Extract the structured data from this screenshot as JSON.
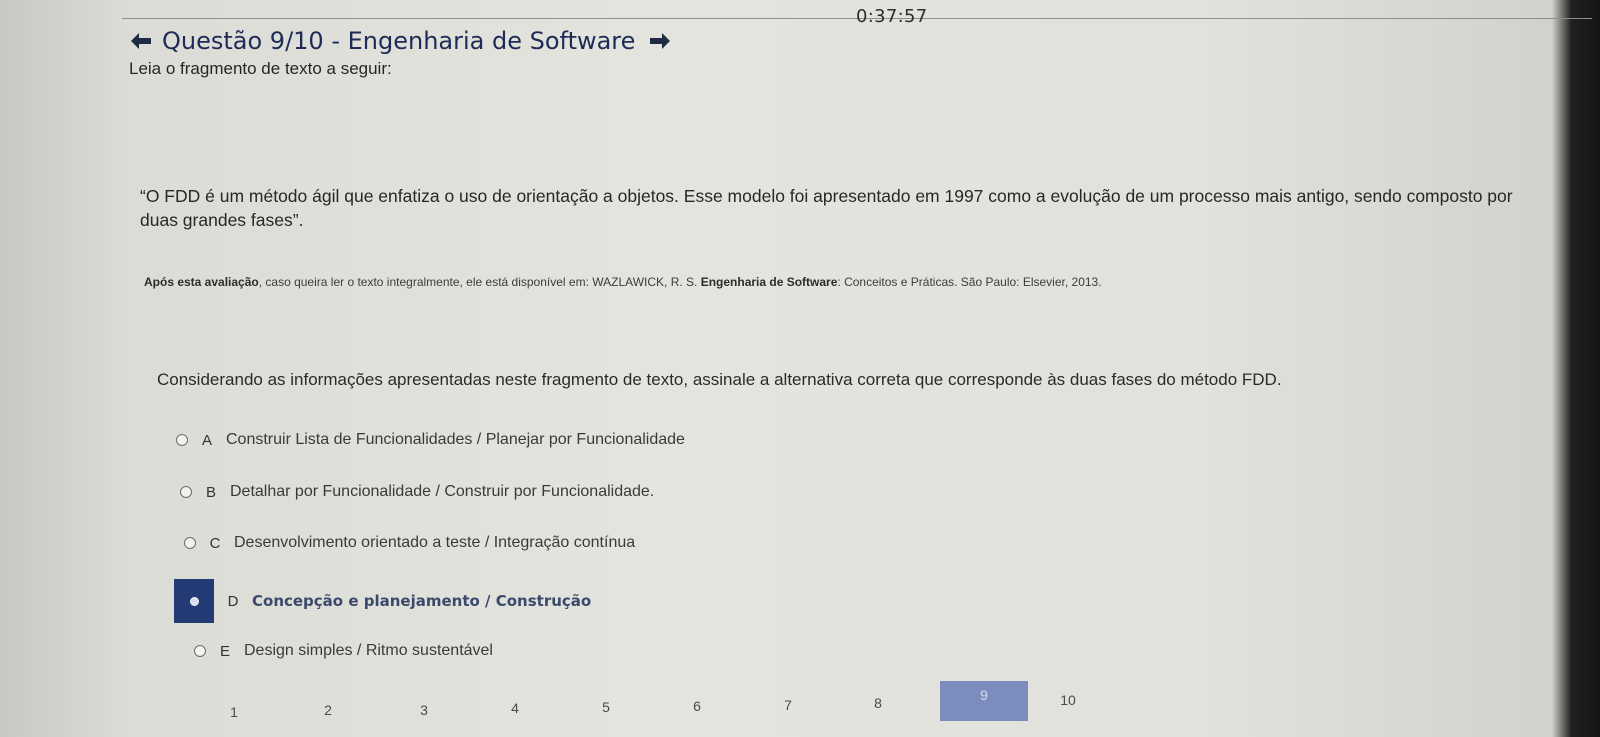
{
  "timer": "0:37:57",
  "header": {
    "title": "Questão 9/10 - Engenharia de Software",
    "prev_icon": "arrow-left-icon",
    "next_icon": "arrow-right-icon"
  },
  "intro": "Leia o fragmento de texto a seguir:",
  "quote": "“O FDD é um método ágil que enfatiza o uso de orientação a objetos. Esse modelo foi apresentado em 1997 como a evolução de um processo mais antigo, sendo composto por duas grandes fases”.",
  "reference": {
    "bold_lead": "Após esta avaliação",
    "text1": ", caso queira ler o texto integralmente, ele está disponível em: WAZLAWICK, R. S. ",
    "bold_title": "Engenharia de Software",
    "text2": ": Conceitos e Práticas. São Paulo: Elsevier, 2013."
  },
  "prompt": "Considerando as informações apresentadas neste fragmento de texto, assinale a alternativa correta que corresponde às duas fases do método FDD.",
  "options": [
    {
      "letter": "A",
      "text": "Construir Lista de Funcionalidades / Planejar por Funcionalidade"
    },
    {
      "letter": "B",
      "text": "Detalhar por Funcionalidade / Construir por Funcionalidade."
    },
    {
      "letter": "C",
      "text": "Desenvolvimento orientado a teste / Integração contínua"
    },
    {
      "letter": "D",
      "text": "Concepção e planejamento / Construção"
    },
    {
      "letter": "E",
      "text": "Design simples / Ritmo sustentável"
    }
  ],
  "selected_option": "D",
  "pager": {
    "pages": [
      "1",
      "2",
      "3",
      "4",
      "5",
      "6",
      "7",
      "8",
      "9",
      "10"
    ],
    "current": "9"
  },
  "colors": {
    "title": "#1e2b57",
    "selected": "#243a74",
    "current_page": "#7c8dbd"
  }
}
